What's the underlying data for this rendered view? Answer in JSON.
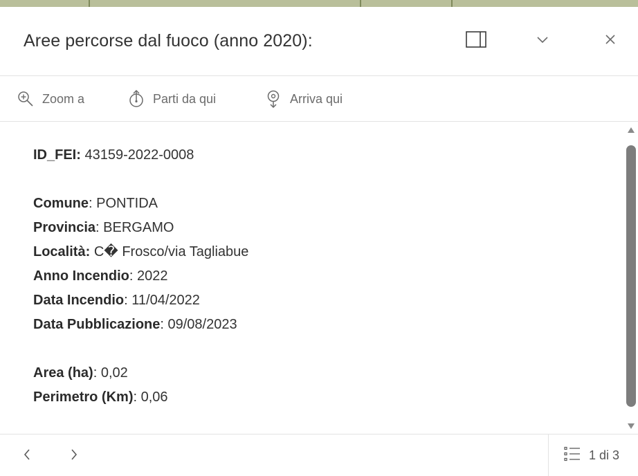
{
  "popup": {
    "title": "Aree percorse dal fuoco (anno 2020):",
    "header_icons": {
      "dock": "dock-panel-icon",
      "collapse": "chevron-down-icon",
      "close": "close-icon"
    },
    "actions": [
      {
        "label": "Zoom a",
        "icon": "zoom-in-icon"
      },
      {
        "label": "Parti da qui",
        "icon": "start-route-icon"
      },
      {
        "label": "Arriva qui",
        "icon": "destination-pin-icon"
      }
    ],
    "id_field": {
      "label": "ID_FEI:",
      "value": "43159-2022-0008"
    },
    "fields_group1": [
      {
        "label": "Comune",
        "sep": ":",
        "value": "PONTIDA"
      },
      {
        "label": "Provincia",
        "sep": ":",
        "value": "BERGAMO"
      },
      {
        "label": "Località:",
        "sep": "",
        "value": "C� Frosco/via Tagliabue"
      },
      {
        "label": "Anno Incendio",
        "sep": ":",
        "value": "2022"
      },
      {
        "label": "Data Incendio",
        "sep": ":",
        "value": "11/04/2022"
      },
      {
        "label": "Data Pubblicazione",
        "sep": ":",
        "value": "09/08/2023"
      }
    ],
    "fields_group2": [
      {
        "label": "Area (ha)",
        "sep": ":",
        "value": "0,02"
      },
      {
        "label": "Perimetro (Km)",
        "sep": ":",
        "value": "0,06"
      }
    ],
    "footer": {
      "prev_icon": "chevron-left-icon",
      "next_icon": "chevron-right-icon",
      "list_icon": "feature-list-icon",
      "pager_text": "1 di 3"
    },
    "colors": {
      "text": "#323232",
      "muted": "#6b6b6b",
      "divider": "#e3e3e3",
      "scroll_thumb": "#7d7d7d",
      "map_strip": "#b9bf9a"
    }
  }
}
